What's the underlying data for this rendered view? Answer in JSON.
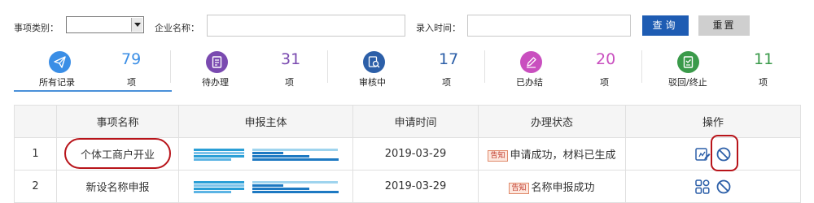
{
  "filters": {
    "category_label": "事项类别：",
    "category_value": "",
    "company_label": "企业名称：",
    "company_value": "",
    "date_label": "录入时间：",
    "date_value": "",
    "query_button": "查询",
    "reset_button": "重置"
  },
  "stats": [
    {
      "label": "所有记录",
      "count": "79",
      "unit": "项",
      "icon": "paper-plane-icon",
      "color": "#3a8ee6",
      "active": true
    },
    {
      "label": "待办理",
      "count": "31",
      "unit": "项",
      "icon": "document-list-icon",
      "color": "#7a4ab0",
      "active": false
    },
    {
      "label": "审核中",
      "count": "17",
      "unit": "项",
      "icon": "review-search-icon",
      "color": "#2c5fa8",
      "active": false
    },
    {
      "label": "已办结",
      "count": "20",
      "unit": "项",
      "icon": "edit-pen-icon",
      "color": "#c94fbf",
      "active": false
    },
    {
      "label": "驳回/终止",
      "count": "11",
      "unit": "项",
      "icon": "reject-document-icon",
      "color": "#3a9a4a",
      "active": false
    }
  ],
  "table": {
    "headers": [
      "",
      "事项名称",
      "申报主体",
      "申请时间",
      "办理状态",
      "操作"
    ],
    "rows": [
      {
        "index": "1",
        "name": "个体工商户开业",
        "subject": "",
        "date": "2019-03-29",
        "status_tag": "告知",
        "status": "申请成功，材料已生成",
        "ops": [
          "view-edit-icon",
          "cancel-icon"
        ]
      },
      {
        "index": "2",
        "name": "新设名称申报",
        "subject": "",
        "date": "2019-03-29",
        "status_tag": "告知",
        "status": "名称申报成功",
        "ops": [
          "grid-apps-icon",
          "cancel-icon"
        ]
      }
    ]
  },
  "colors": {
    "primary": "#1e5cb3",
    "annotation_red": "#b8141a",
    "tag_red": "#c0392b"
  }
}
